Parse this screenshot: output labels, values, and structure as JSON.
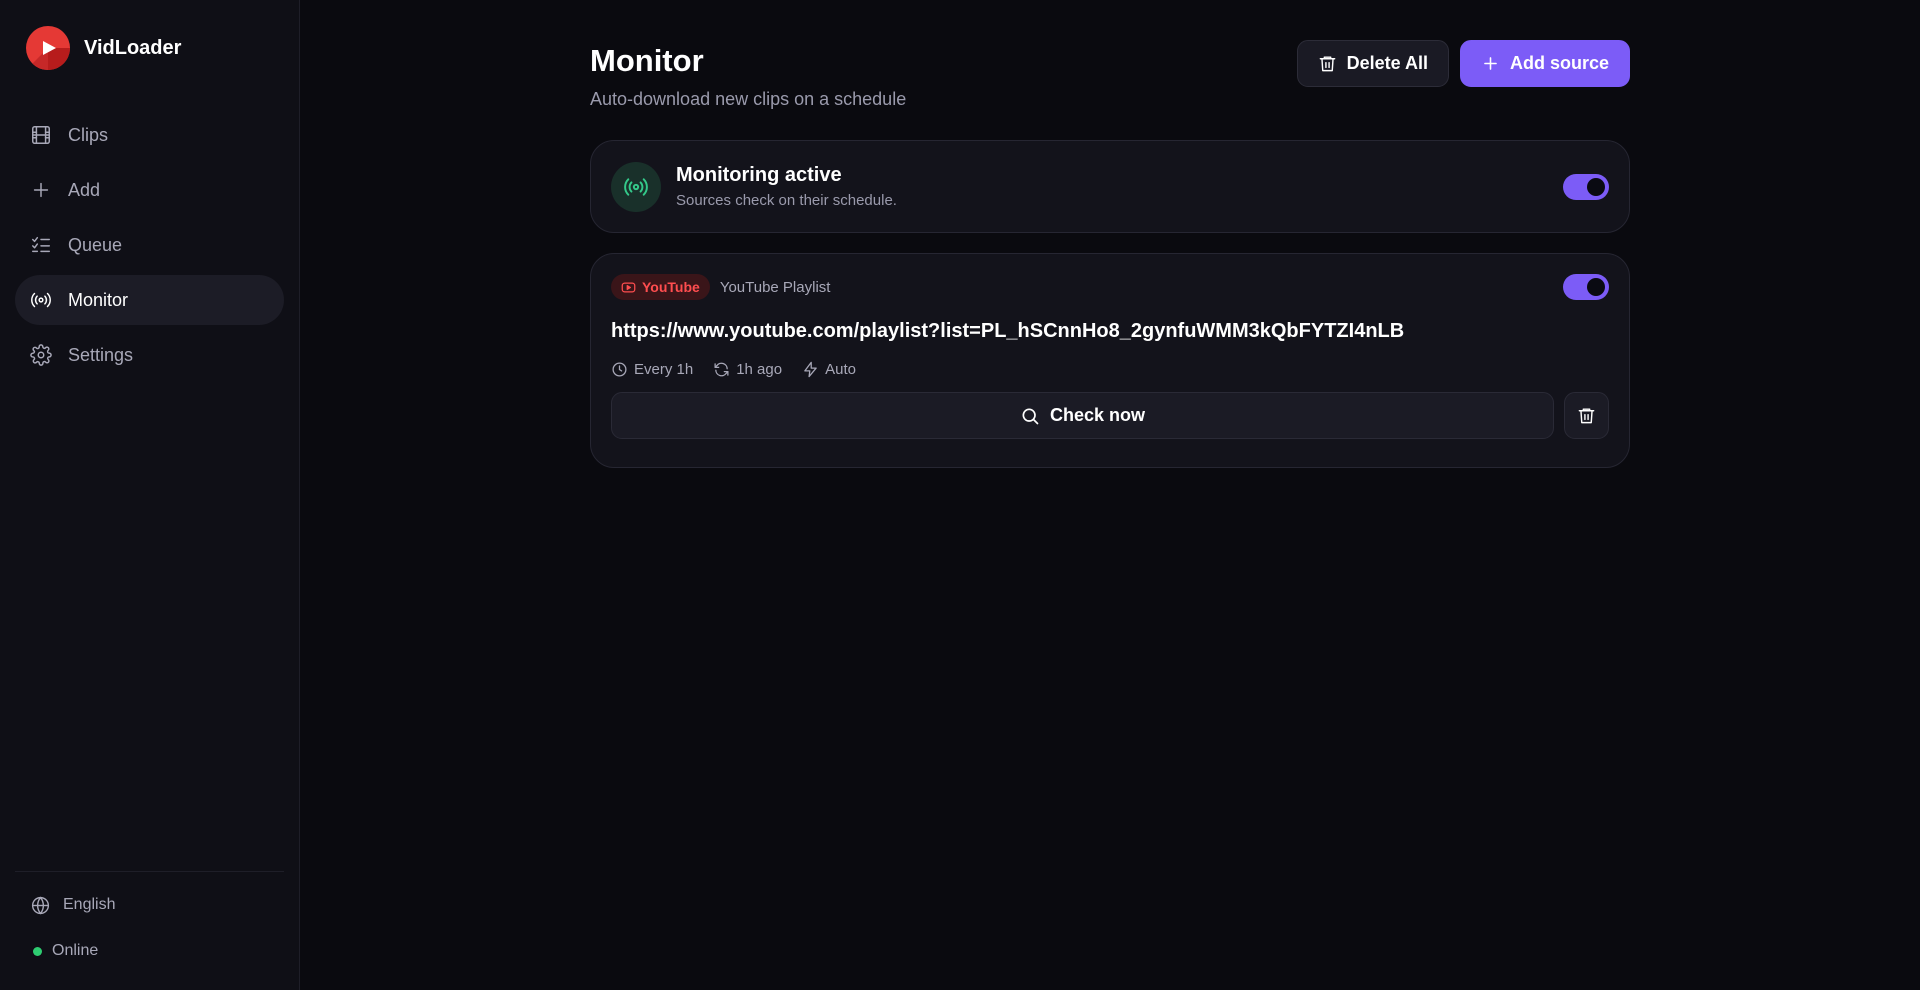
{
  "app": {
    "name": "VidLoader"
  },
  "sidebar": {
    "items": [
      {
        "label": "Clips",
        "icon": "film-icon"
      },
      {
        "label": "Add",
        "icon": "plus-icon"
      },
      {
        "label": "Queue",
        "icon": "list-check-icon"
      },
      {
        "label": "Monitor",
        "icon": "radar-icon",
        "active": true
      },
      {
        "label": "Settings",
        "icon": "gear-icon"
      }
    ],
    "language": "English",
    "status": "Online"
  },
  "page": {
    "title": "Monitor",
    "subtitle": "Auto-download new clips on a schedule",
    "delete_all_label": "Delete All",
    "add_source_label": "Add source"
  },
  "monitoring": {
    "title": "Monitoring active",
    "description": "Sources check on their schedule.",
    "enabled": true
  },
  "sources": [
    {
      "platform": "YouTube",
      "type": "YouTube Playlist",
      "url": "https://www.youtube.com/playlist?list=PL_hSCnnHo8_2gynfuWMM3kQbFYTZI4nLB",
      "interval": "Every 1h",
      "last_checked": "1h ago",
      "mode": "Auto",
      "enabled": true,
      "check_label": "Check now"
    }
  ],
  "colors": {
    "accent": "#7c5cf7",
    "youtube": "#ff4d4f",
    "online": "#2ecc71",
    "monitor_icon": "#34c98a"
  }
}
